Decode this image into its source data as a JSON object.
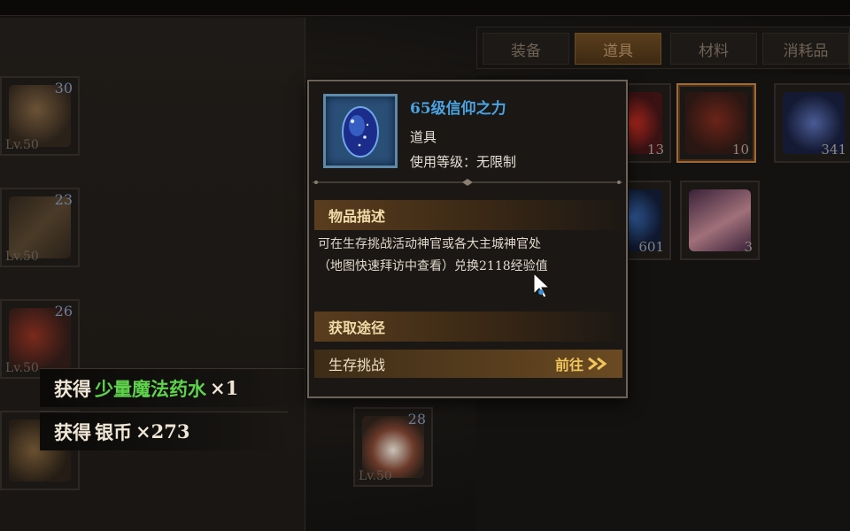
{
  "tabs": [
    {
      "label": "装备",
      "active": false
    },
    {
      "label": "道具",
      "active": true
    },
    {
      "label": "材料",
      "active": false
    },
    {
      "label": "消耗品",
      "active": false
    }
  ],
  "left_slots": [
    {
      "icon": "helmet-icon",
      "count": "30",
      "level": "Lv.50"
    },
    {
      "icon": "bow-icon",
      "count": "23",
      "level": "Lv.50"
    },
    {
      "icon": "armor-icon",
      "count": "26",
      "level": "Lv.50"
    },
    {
      "icon": "belt-icon",
      "count": "",
      "level": ""
    }
  ],
  "center_slot": {
    "icon": "boots-icon",
    "count": "28",
    "level": "Lv.50"
  },
  "right_slots": [
    {
      "icon": "red-gem-icon",
      "count": "13"
    },
    {
      "icon": "scroll-icon",
      "count": "10"
    },
    {
      "icon": "blue-stone-icon",
      "count": "341"
    },
    {
      "icon": "blue-gem-icon",
      "count": "601"
    },
    {
      "icon": "card-icon",
      "count": "3"
    }
  ],
  "messages": [
    {
      "prefix": "获得",
      "item": "少量魔法药水",
      "qty": "×1",
      "item_color": "#5fd24c"
    },
    {
      "prefix": "获得",
      "item": "银币",
      "qty": "×273",
      "item_color": "#efe6d6"
    }
  ],
  "tooltip": {
    "name": "65级信仰之力",
    "type": "道具",
    "use_level": "使用等级：无限制",
    "desc_title": "物品描述",
    "desc_line1": "可在生存挑战活动神官或各大主城神官处",
    "desc_line2": "（地图快速拜访中查看）兑换2118经验值",
    "source_title": "获取途径",
    "source_name": "生存挑战",
    "go_label": "前往",
    "icon": "blue-stone-icon"
  },
  "colors": {
    "item_name": "#4aa3e2",
    "go": "#f0c55c",
    "highlight_green": "#5fd24c"
  }
}
